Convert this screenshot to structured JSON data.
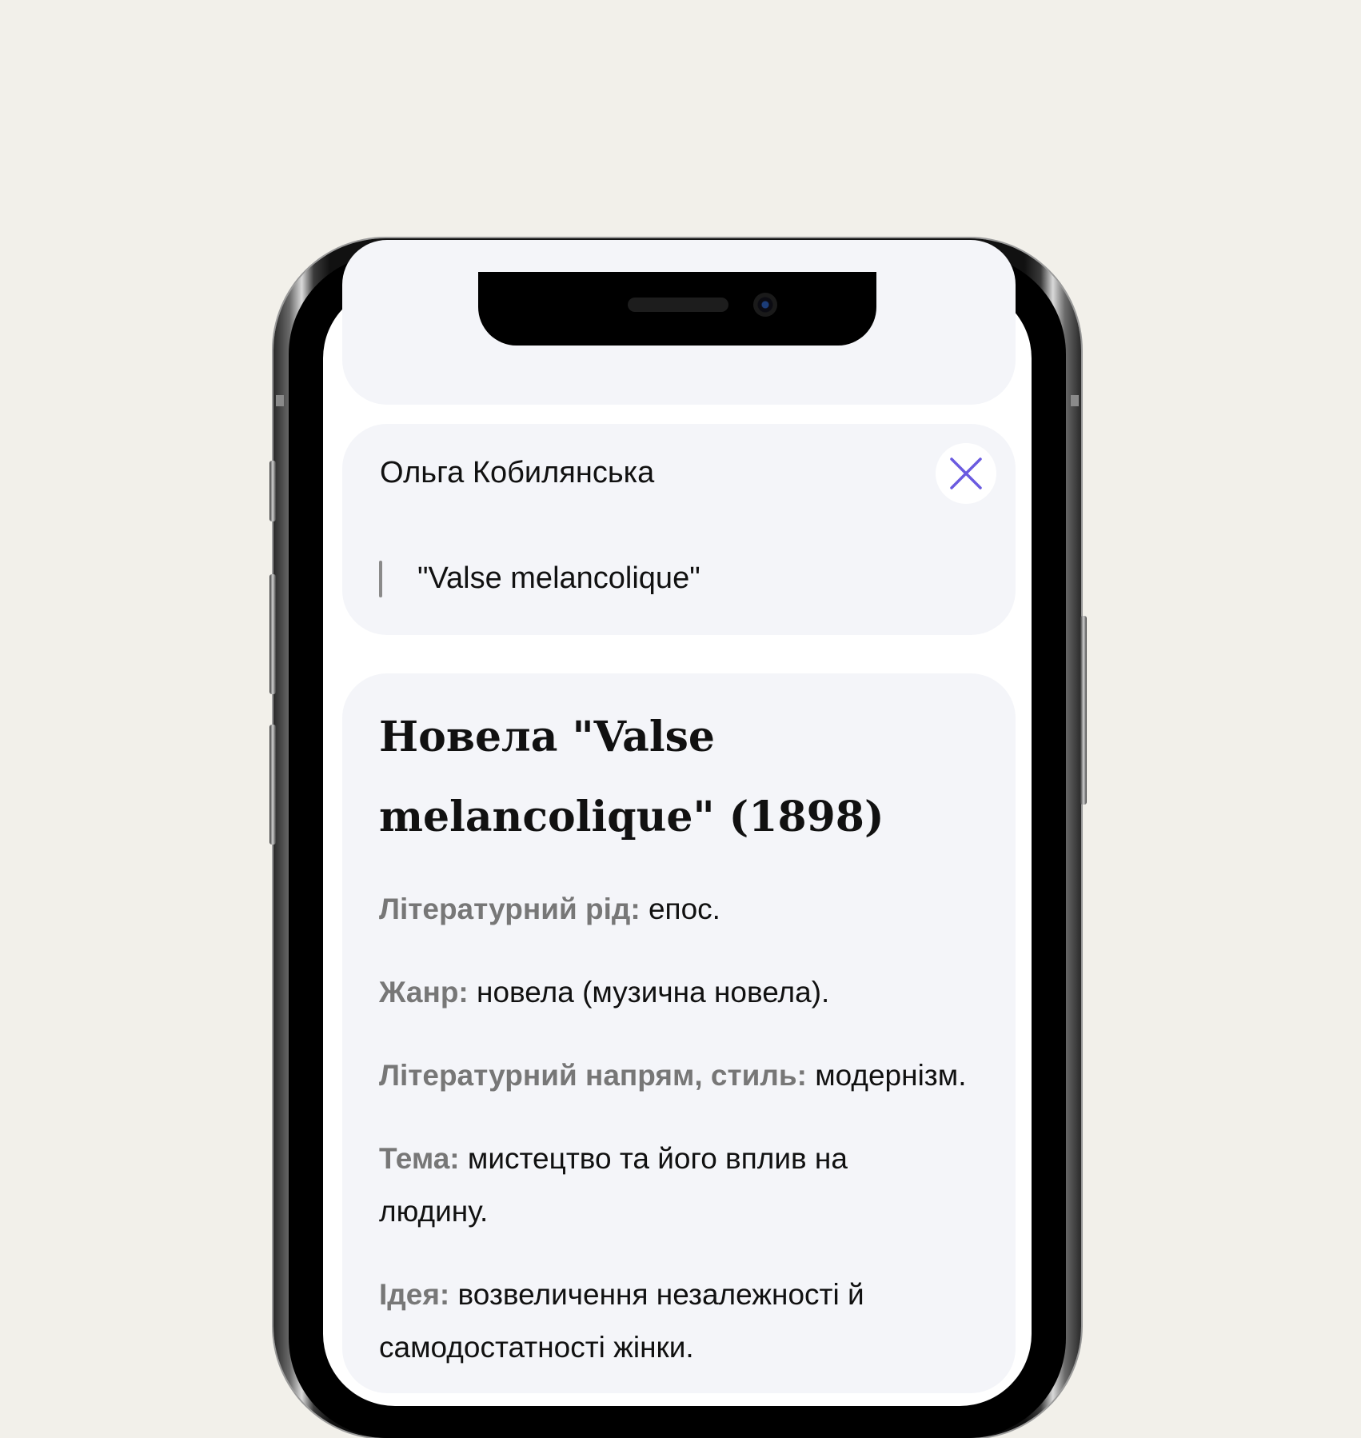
{
  "search": {
    "author": "Ольга Кобилянська",
    "query": "\"Valse melancolique\""
  },
  "work": {
    "title_line1": "Новела \"Valse",
    "title_line2": "melancolique\" (1898)",
    "facts": [
      {
        "label": "Літературний рід:",
        "value": "епос."
      },
      {
        "label": "Жанр:",
        "value": "новела (музична новела)."
      },
      {
        "label": "Літературний напрям, стиль:",
        "value": "модернізм."
      },
      {
        "label": "Тема:",
        "value": "мистецтво та його вплив на людину."
      },
      {
        "label": "Ідея:",
        "value": "возвеличення незалежності й самодостатності жінки."
      }
    ]
  },
  "colors": {
    "background": "#f2f0ea",
    "card": "#f4f5f9",
    "accent": "#6a5ae0",
    "label": "#777777"
  },
  "icons": {
    "close": "close-icon"
  }
}
